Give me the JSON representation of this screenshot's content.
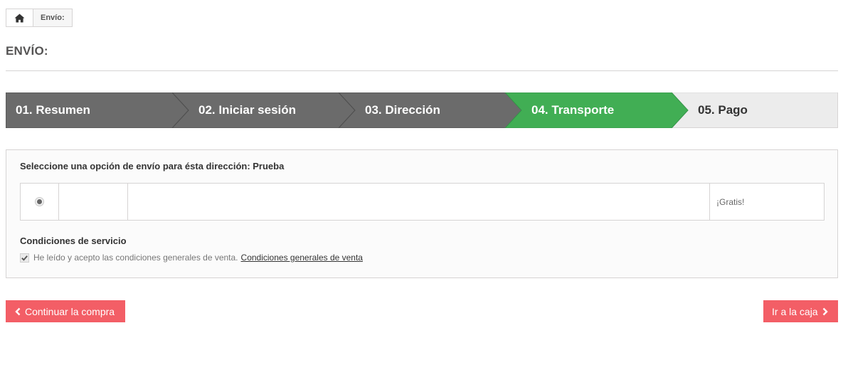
{
  "breadcrumb": {
    "home_icon": "home-icon",
    "current": "Envío:"
  },
  "page": {
    "title": "ENVÍO:"
  },
  "steps": [
    {
      "label": "01. Resumen",
      "state": "done"
    },
    {
      "label": "02. Iniciar sesión",
      "state": "done"
    },
    {
      "label": "03. Dirección",
      "state": "done"
    },
    {
      "label": "04. Transporte",
      "state": "current"
    },
    {
      "label": "05. Pago",
      "state": "future"
    }
  ],
  "colors": {
    "done": "#6b6b6b",
    "current": "#41ae54",
    "future": "#ececec",
    "button": "#f35e66"
  },
  "carrier": {
    "heading": "Seleccione una opción de envío para ésta dirección: Prueba",
    "option": {
      "selected": true,
      "price": "¡Gratis!"
    }
  },
  "terms": {
    "heading": "Condiciones de servicio",
    "checked": true,
    "text": "He leído y acepto las condiciones generales de venta.",
    "link": "Condiciones generales de venta"
  },
  "buttons": {
    "back": "Continuar la compra",
    "next": "Ir a la caja"
  }
}
